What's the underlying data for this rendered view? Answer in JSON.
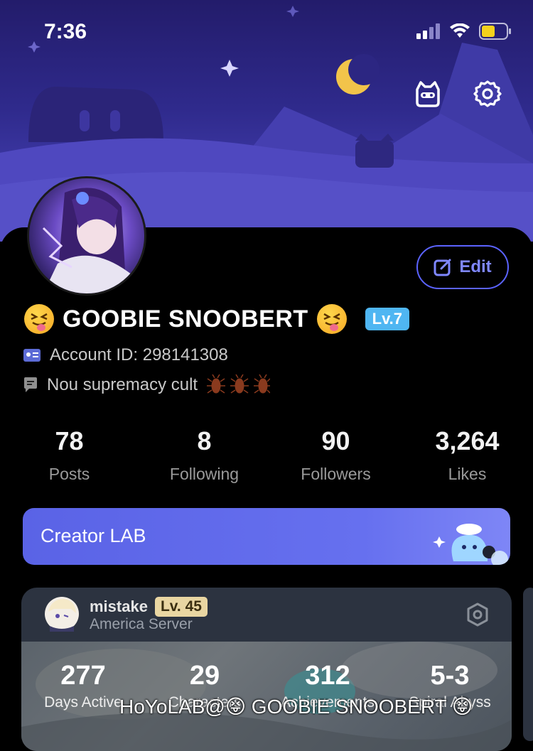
{
  "status_bar": {
    "time": "7:36"
  },
  "profile": {
    "name": "GOOBIE SNOOBERT",
    "level_badge": "Lv.7",
    "account_id": "Account ID: 298141308",
    "bio": "Nou supremacy cult",
    "edit_label": "Edit"
  },
  "stats": [
    {
      "value": "78",
      "label": "Posts"
    },
    {
      "value": "8",
      "label": "Following"
    },
    {
      "value": "90",
      "label": "Followers"
    },
    {
      "value": "3,264",
      "label": "Likes"
    }
  ],
  "creator_lab": {
    "label": "Creator LAB"
  },
  "game_card": {
    "nickname": "mistake",
    "level": "Lv. 45",
    "server": "America Server",
    "stats": [
      {
        "value": "277",
        "label": "Days Active"
      },
      {
        "value": "29",
        "label": "Characters"
      },
      {
        "value": "312",
        "label": "Achievements"
      },
      {
        "value": "5-3",
        "label": "Spiral Abyss"
      }
    ]
  },
  "watermark": "HoYoLAB@😝 GOOBIE SNOOBERT 😝",
  "colors": {
    "accent": "#5b63ff",
    "level_badge": "#4fb6f2",
    "creator_banner": "#5a63e6"
  }
}
